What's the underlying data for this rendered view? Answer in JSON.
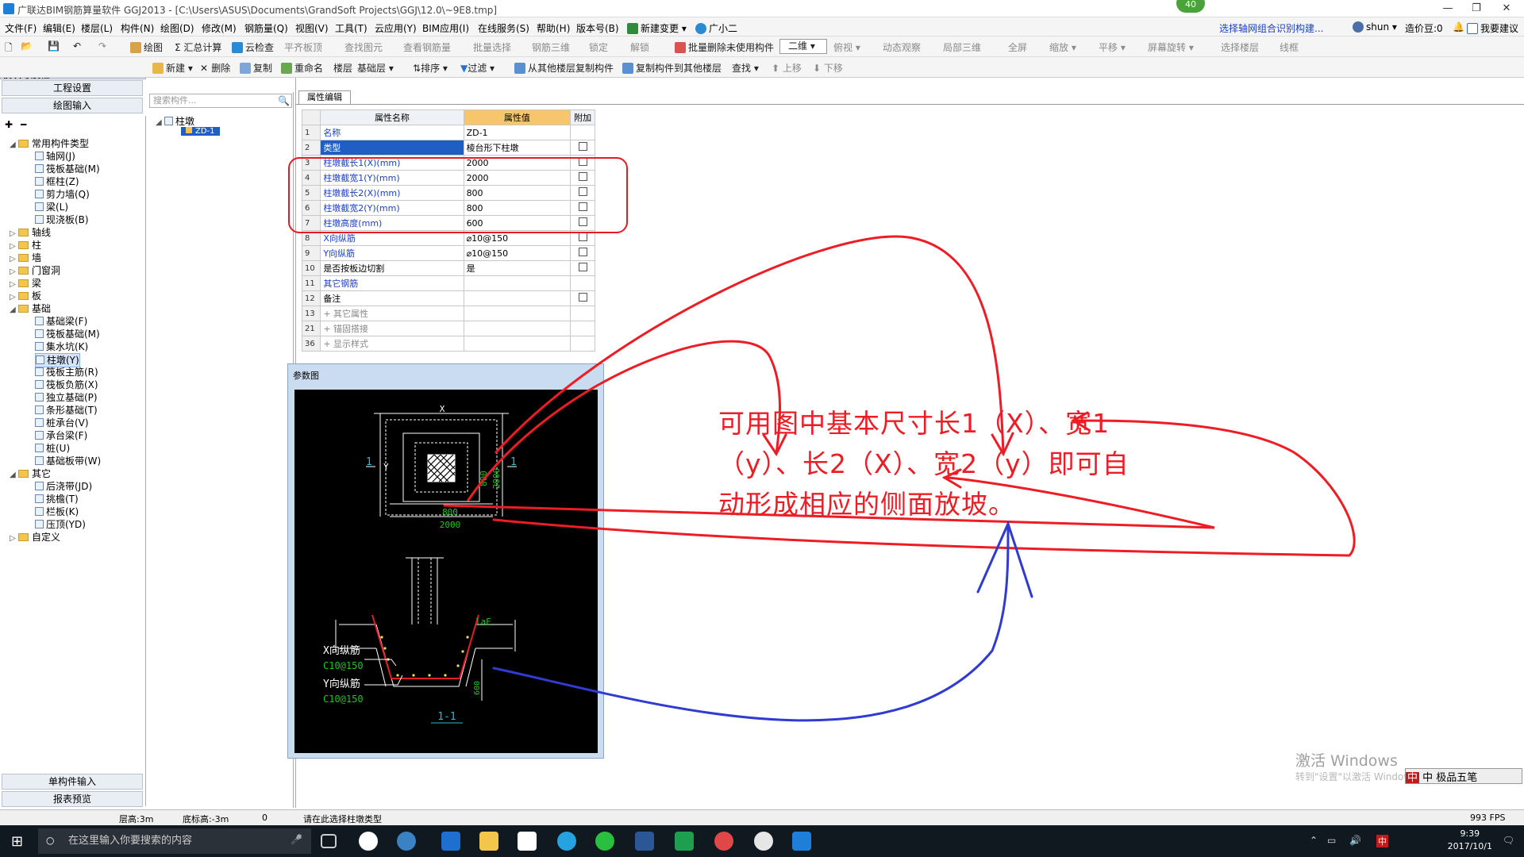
{
  "titlebar": {
    "title": "广联达BIM钢筋算量软件 GGJ2013 - [C:\\Users\\ASUS\\Documents\\GrandSoft Projects\\GGJ\\12.0\\~9E8.tmp]",
    "badge": "40",
    "min": "—",
    "max": "❐",
    "close": "✕"
  },
  "menu": [
    "文件(F)",
    "编辑(E)",
    "楼层(L)",
    "构件(N)",
    "绘图(D)",
    "修改(M)",
    "钢筋量(Q)",
    "视图(V)",
    "工具(T)",
    "云应用(Y)",
    "BIM应用(I)",
    "在线服务(S)",
    "帮助(H)",
    "版本号(B)",
    "新建变更 ▾",
    "广小二"
  ],
  "menu_right": {
    "notice": "选择轴网组合识别构建...",
    "user": "shun ▾",
    "coins": "造价豆:0",
    "suggest": "我要建议"
  },
  "toolbar1": {
    "draw": "绘图",
    "sum": "Σ 汇总计算",
    "cloudcheck": "云检查",
    "flat": "平齐板顶",
    "find": "查找图元",
    "viewrebar": "查看钢筋量",
    "batchsel": "批量选择",
    "rebar3d": "钢筋三维",
    "lock": "锁定",
    "unlock": "解锁",
    "batchdel": "批量删除未使用构件",
    "mode": "二维",
    "top": "俯视 ▾",
    "dyn": "动态观察",
    "local3d": "局部三维",
    "full": "全屏",
    "zoom": "缩放 ▾",
    "pan": "平移 ▾",
    "rotate": "屏幕旋转 ▾",
    "selfloor": "选择楼层",
    "wire": "线框"
  },
  "leftpane": {
    "header": "模块导航栏",
    "btn_project": "工程设置",
    "btn_draw": "绘图输入",
    "btn_single": "单构件输入",
    "btn_report": "报表预览"
  },
  "toolbar2": {
    "new": "新建 ▾",
    "delete": "删除",
    "copy": "复制",
    "rename": "重命名",
    "floor": "楼层",
    "floor_val": "基础层",
    "sort": "排序 ▾",
    "filter": "过滤 ▾",
    "copy_from": "从其他楼层复制构件",
    "copy_to": "复制构件到其他楼层",
    "find": "查找 ▾",
    "up": "上移",
    "down": "下移"
  },
  "tree": {
    "common": "常用构件类型",
    "common_items": [
      "轴网(J)",
      "筏板基础(M)",
      "框柱(Z)",
      "剪力墙(Q)",
      "梁(L)",
      "现浇板(B)"
    ],
    "folders1": [
      "轴线",
      "柱",
      "墙",
      "门窗洞",
      "梁",
      "板"
    ],
    "found": "基础",
    "found_items": [
      "基础梁(F)",
      "筏板基础(M)",
      "集水坑(K)",
      "柱墩(Y)",
      "筏板主筋(R)",
      "筏板负筋(X)",
      "独立基础(P)",
      "条形基础(T)",
      "桩承台(V)",
      "承台梁(F)",
      "桩(U)",
      "基础板带(W)"
    ],
    "other": "其它",
    "other_items": [
      "后浇带(JD)",
      "挑檐(T)",
      "栏板(K)",
      "压顶(YD)"
    ],
    "custom": "自定义"
  },
  "midpane": {
    "search_placeholder": "搜索构件...",
    "root": "柱墩",
    "child": "ZD-1"
  },
  "props": {
    "tab": "属性编辑",
    "headers": [
      "属性名称",
      "属性值",
      "附加"
    ],
    "rows": [
      {
        "n": "1",
        "name": "名称",
        "val": "ZD-1",
        "cb": false
      },
      {
        "n": "2",
        "name": "类型",
        "val": "棱台形下柱墩",
        "cb": true
      },
      {
        "n": "3",
        "name": "柱墩截长1(X)(mm)",
        "val": "2000",
        "cb": true
      },
      {
        "n": "4",
        "name": "柱墩截宽1(Y)(mm)",
        "val": "2000",
        "cb": true
      },
      {
        "n": "5",
        "name": "柱墩截长2(X)(mm)",
        "val": "800",
        "cb": true
      },
      {
        "n": "6",
        "name": "柱墩截宽2(Y)(mm)",
        "val": "800",
        "cb": true
      },
      {
        "n": "7",
        "name": "柱墩高度(mm)",
        "val": "600",
        "cb": true
      },
      {
        "n": "8",
        "name": "X向纵筋",
        "val": "⌀10@150",
        "cb": true
      },
      {
        "n": "9",
        "name": "Y向纵筋",
        "val": "⌀10@150",
        "cb": true
      },
      {
        "n": "10",
        "name": "是否按板边切割",
        "val": "是",
        "cb": true
      },
      {
        "n": "11",
        "name": "其它钢筋",
        "val": "",
        "cb": false
      },
      {
        "n": "12",
        "name": "备注",
        "val": "",
        "cb": true
      },
      {
        "n": "13",
        "name": "+ 其它属性",
        "val": "",
        "cb": false
      },
      {
        "n": "21",
        "name": "+ 锚固搭接",
        "val": "",
        "cb": false
      },
      {
        "n": "36",
        "name": "+ 显示样式",
        "val": "",
        "cb": false
      }
    ]
  },
  "param": {
    "title": "参数图",
    "dimX": "X",
    "dimY": "Y",
    "dim800v": "800",
    "dim2000v": "2000",
    "dim800h": "800",
    "dim2000h": "2000",
    "sec": "1",
    "sec2": "1",
    "lae": "laE",
    "h": "600",
    "xbar": "X向纵筋",
    "xbar_val": "C10@150",
    "ybar": "Y向纵筋",
    "ybar_val": "C10@150",
    "seclabel": "1-1"
  },
  "annotation": "可用图中基本尺寸长1（X）、宽1（y）、长2（X）、宽2（y）即可自动形成相应的侧面放坡。",
  "watermark": {
    "line1": "激活 Windows",
    "line2": "转到\"设置\"以激活 Windows。"
  },
  "ime": "中 极品五笔",
  "status": {
    "floorh": "层高:3m",
    "bottom": "底标高:-3m",
    "zero": "0",
    "msg": "请在此选择柱墩类型",
    "fps": "993 FPS"
  },
  "taskbar": {
    "search": "在这里输入你要搜索的内容",
    "time": "9:39",
    "date": "2017/10/1",
    "ime": "中"
  },
  "colors": {
    "accent": "#1e7fd8",
    "annotation": "#ee1c24",
    "annotation_blue": "#2f3bd1",
    "cad_bg": "#000000",
    "cad_green": "#21c421"
  }
}
